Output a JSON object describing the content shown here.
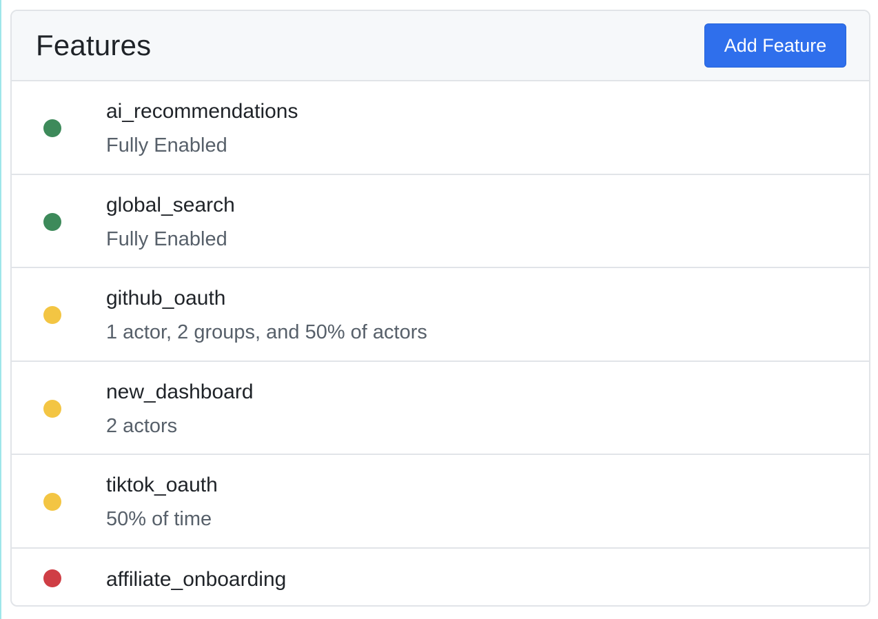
{
  "header": {
    "title": "Features",
    "add_button_label": "Add Feature"
  },
  "colors": {
    "enabled": "#3d8a5a",
    "conditional": "#f3c543",
    "disabled": "#cf3e45",
    "primary": "#2f6fec"
  },
  "features": [
    {
      "name": "ai_recommendations",
      "status": "enabled",
      "description": "Fully Enabled"
    },
    {
      "name": "global_search",
      "status": "enabled",
      "description": "Fully Enabled"
    },
    {
      "name": "github_oauth",
      "status": "conditional",
      "description": "1 actor, 2 groups, and 50% of actors"
    },
    {
      "name": "new_dashboard",
      "status": "conditional",
      "description": "2 actors"
    },
    {
      "name": "tiktok_oauth",
      "status": "conditional",
      "description": "50% of time"
    },
    {
      "name": "affiliate_onboarding",
      "status": "disabled",
      "description": ""
    }
  ]
}
